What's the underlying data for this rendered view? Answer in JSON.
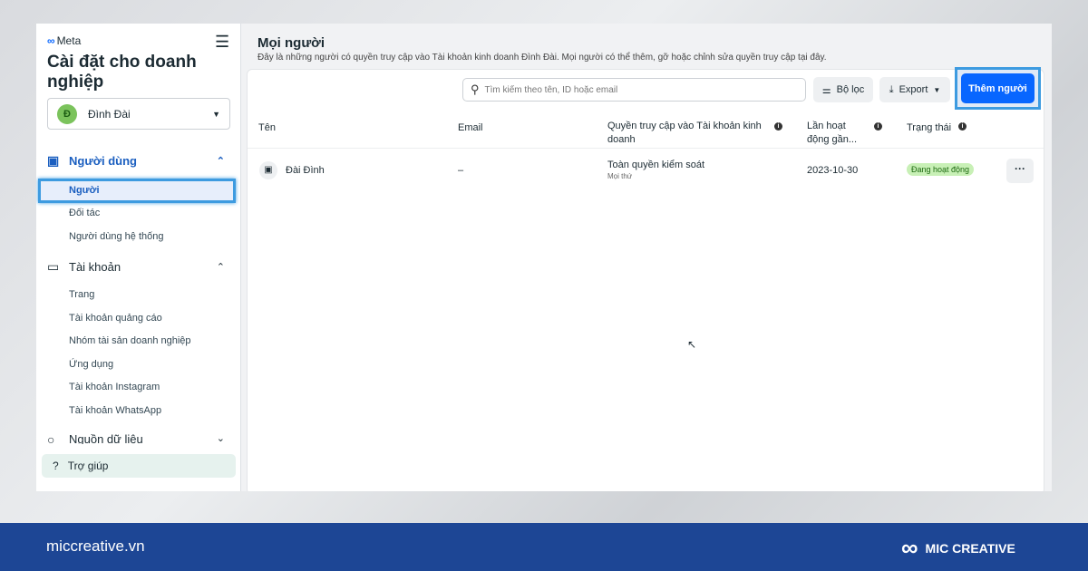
{
  "sidebar": {
    "logo": "Meta",
    "title": "Cài đặt cho doanh nghiệp",
    "account": {
      "initial": "Đ",
      "name": "Đình Đài"
    },
    "sections": [
      {
        "label": "Người dùng",
        "items": [
          "Người",
          "Đối tác",
          "Người dùng hệ thống"
        ]
      },
      {
        "label": "Tài khoản",
        "items": [
          "Trang",
          "Tài khoản quảng cáo",
          "Nhóm tài sản doanh nghiệp",
          "Ứng dụng",
          "Tài khoản Instagram",
          "Tài khoản WhatsApp"
        ]
      },
      {
        "label": "Nguồn dữ liệu",
        "items": []
      }
    ],
    "help": "Trợ giúp"
  },
  "main": {
    "title": "Mọi người",
    "description": "Đây là những người có quyền truy cập vào Tài khoản kinh doanh Đình Đài. Mọi người có thể thêm, gỡ hoặc chỉnh sửa quyền truy cập tại đây.",
    "search_placeholder": "Tìm kiếm theo tên, ID hoặc email",
    "filter": "Bộ lọc",
    "export": "Export",
    "add": "Thêm người",
    "columns": [
      "Tên",
      "Email",
      "Quyền truy cập vào Tài khoản kinh doanh",
      "Lần hoạt động gần...",
      "Trạng thái"
    ],
    "rows": [
      {
        "name": "Đài Đình",
        "email": "–",
        "access": "Toàn quyền kiểm soát",
        "access_sub": "Mọi thứ",
        "last_active": "2023-10-30",
        "status": "Đang hoạt động"
      }
    ]
  },
  "footer": {
    "site": "miccreative.vn",
    "brand": "MIC CREATIVE"
  },
  "colors": {
    "accent": "#0866ff",
    "highlight": "#3d9be0",
    "footer": "#1d4695",
    "status": "#c8f0b6"
  }
}
